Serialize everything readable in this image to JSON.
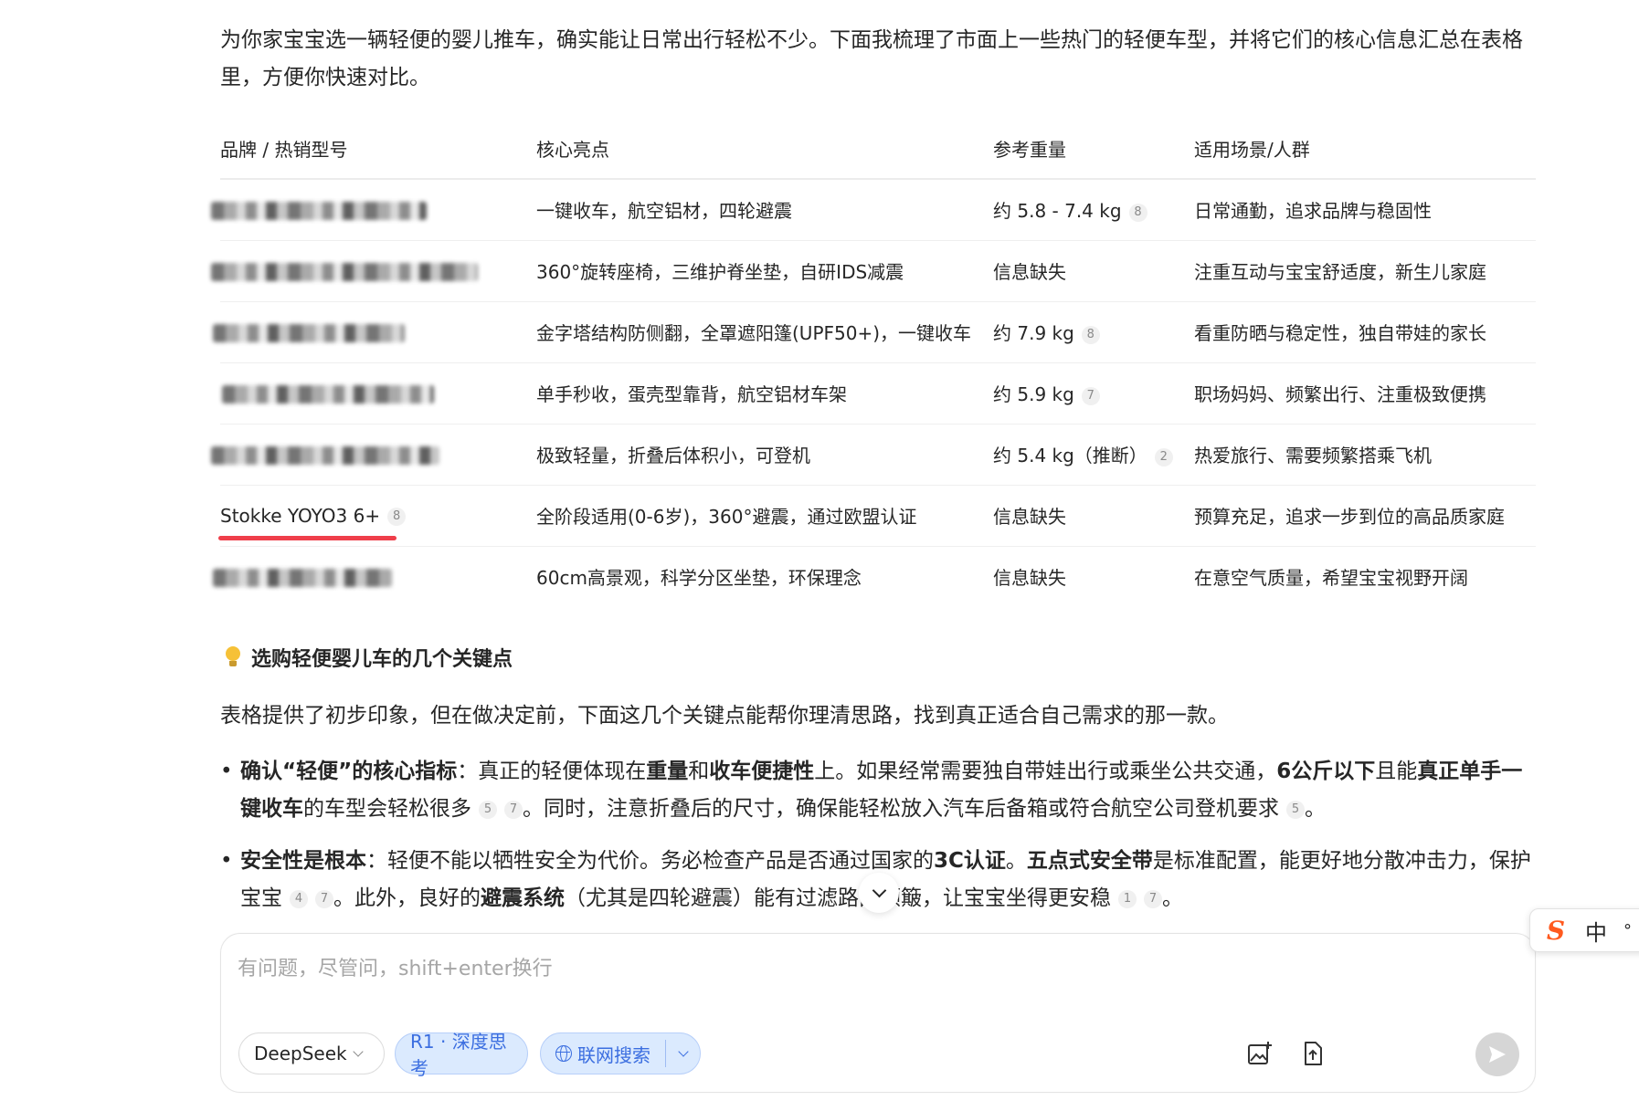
{
  "intro": "为你家宝宝选一辆轻便的婴儿推车，确实能让日常出行轻松不少。下面我梳理了市面上一些热门的轻便车型，并将它们的核心信息汇总在表格里，方便你快速对比。",
  "table": {
    "headers": [
      "品牌 / 热销型号",
      "核心亮点",
      "参考重量",
      "适用场景/人群"
    ],
    "rows": [
      {
        "brand": "",
        "features": "一键收车，航空铝材，四轮避震",
        "weight": "约 5.8 - 7.4 kg",
        "weight_cite": "8",
        "scene": "日常通勤，追求品牌与稳固性"
      },
      {
        "brand": "",
        "features": "360°旋转座椅，三维护脊坐垫，自研IDS减震",
        "weight": "信息缺失",
        "weight_cite": "",
        "scene": "注重互动与宝宝舒适度，新生儿家庭"
      },
      {
        "brand": "",
        "features": "金字塔结构防侧翻，全罩遮阳篷(UPF50+)，一键收车",
        "weight": "约 7.9 kg",
        "weight_cite": "8",
        "scene": "看重防晒与稳定性，独自带娃的家长"
      },
      {
        "brand": "",
        "features": "单手秒收，蛋壳型靠背，航空铝材车架",
        "weight": "约 5.9 kg",
        "weight_cite": "7",
        "scene": "职场妈妈、频繁出行、注重极致便携"
      },
      {
        "brand": "",
        "features": "极致轻量，折叠后体积小，可登机",
        "weight": "约 5.4 kg（推断）",
        "weight_cite": "2",
        "scene": "热爱旅行、需要频繁搭乘飞机"
      },
      {
        "brand": "Stokke YOYO3 6+",
        "brand_cite": "8",
        "features": "全阶段适用(0-6岁)，360°避震，通过欧盟认证",
        "weight": "信息缺失",
        "weight_cite": "",
        "scene": "预算充足，追求一步到位的高品质家庭"
      },
      {
        "brand": "",
        "features": "60cm高景观，科学分区坐垫，环保理念",
        "weight": "信息缺失",
        "weight_cite": "",
        "scene": "在意空气质量，希望宝宝视野开阔"
      }
    ]
  },
  "section_title": "选购轻便婴儿车的几个关键点",
  "section_intro": "表格提供了初步印象，但在做决定前，下面这几个关键点能帮你理清思路，找到真正适合自己需求的那一款。",
  "points": [
    {
      "p1_bold": "确认“轻便”的核心指标",
      "p1_text": "：真正的轻便体现在",
      "p1_b2": "重量",
      "p1_t2": "和",
      "p1_b3": "收车便捷性",
      "p1_t3": "上。如果经常需要独自带娃出行或乘坐公共交通，",
      "p1_b4": "6公斤以下",
      "p1_t4": "且能",
      "p1_b5": "真正单手一键收车",
      "p1_t5": "的车型会轻松很多",
      "cite_a": "5",
      "cite_b": "7",
      "p1_t6": "。同时，注意折叠后的尺寸，确保能轻松放入汽车后备箱或符合航空公司登机要求",
      "cite_c": "5",
      "p1_t7": "。"
    },
    {
      "p2_bold": "安全性是根本",
      "p2_text": "：轻便不能以牺牲安全为代价。务必检查产品是否通过国家的",
      "p2_b2": "3C认证",
      "p2_t2": "。",
      "p2_b3": "五点式安全带",
      "p2_t3": "是标准配置，能更好地分散冲击力，保护宝宝",
      "cite_a": "4",
      "cite_b": "7",
      "p2_t4": "。此外，良好的",
      "p2_b4": "避震系统",
      "p2_t5": "（尤其是四轮避震）能有",
      "p2_t6": "过滤路面颠簸，让宝宝坐得更安稳",
      "cite_c": "1",
      "cite_d": "7",
      "p2_t7": "。"
    }
  ],
  "input": {
    "placeholder": "有问题，尽管问，shift+enter换行"
  },
  "toolbar": {
    "model": "DeepSeek",
    "deep_think": "R1 · 深度思考",
    "web_search": "联网搜索"
  },
  "ime": {
    "lang": "中",
    "punct": "°"
  },
  "colors": {
    "accent": "#3b6ee0",
    "underline": "#ef3e4a",
    "ime_logo": "#ff5a1f"
  }
}
